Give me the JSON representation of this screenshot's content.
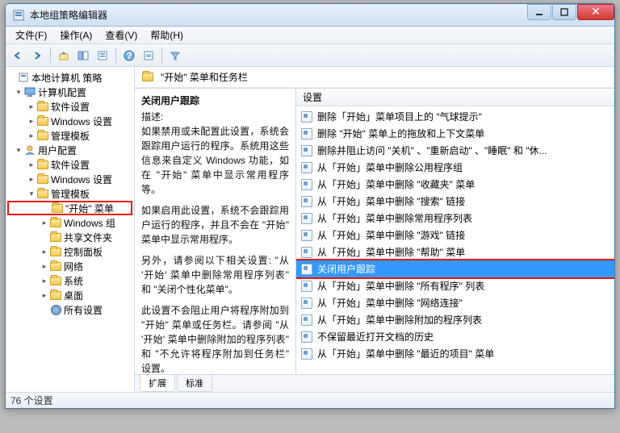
{
  "window": {
    "title": "本地组策略编辑器"
  },
  "menu": {
    "file": "文件(F)",
    "action": "操作(A)",
    "view": "查看(V)",
    "help": "帮助(H)"
  },
  "tree": {
    "root": "本地计算机 策略",
    "computer": "计算机配置",
    "c_soft": "软件设置",
    "c_win": "Windows 设置",
    "c_admin": "管理模板",
    "user": "用户配置",
    "u_soft": "软件设置",
    "u_win": "Windows 设置",
    "u_admin": "管理模板",
    "start": "\"开始\" 菜单",
    "wincomp": "Windows 组",
    "shared": "共享文件夹",
    "ctrl": "控制面板",
    "net": "网络",
    "sys": "系统",
    "desk": "桌面",
    "all": "所有设置"
  },
  "header": {
    "title": "\"开始\" 菜单和任务栏"
  },
  "desc": {
    "title": "关闭用户跟踪",
    "label": "描述:",
    "p1": "如果禁用或未配置此设置，系统会跟踪用户运行的程序。系统用这些信息来自定义 Windows 功能，如在 \"开始\" 菜单中显示常用程序等。",
    "p2": "如果启用此设置，系统不会跟踪用户运行的程序，并且不会在 \"开始\" 菜单中显示常用程序。",
    "p3": "另外，请参阅以下相关设置: \"从 '开始' 菜单中删除常用程序列表\" 和 \"关闭个性化菜单\"。",
    "p4": "此设置不会阻止用户将程序附加到 \"开始\" 菜单或任务栏。请参阅 \"从 '开始' 菜单中删除附加的程序列表\" 和 \"不允许将程序附加到任务栏\" 设置。"
  },
  "listHeader": "设置",
  "settings": [
    "删除「开始」菜单项目上的 \"气球提示\"",
    "删除 \"开始\" 菜单上的拖放和上下文菜单",
    "删除并阻止访问 \"关机\" 、\"重新启动\" 、\"睡眠\" 和 \"休...",
    "从「开始」菜单中删除公用程序组",
    "从「开始」菜单中删除 \"收藏夹\" 菜单",
    "从「开始」菜单中删除 \"搜索\" 链接",
    "从「开始」菜单中删除常用程序列表",
    "从「开始」菜单中删除 \"游戏\" 链接",
    "从「开始」菜单中删除 \"帮助\" 菜单",
    "关闭用户跟踪",
    "从「开始」菜单中删除 \"所有程序\" 列表",
    "从「开始」菜单中删除 \"网络连接\"",
    "从「开始」菜单中删除附加的程序列表",
    "不保留最近打开文档的历史",
    "从「开始」菜单中删除 \"最近的项目\" 菜单"
  ],
  "selectedIndex": 9,
  "tabs": {
    "ext": "扩展",
    "std": "标准"
  },
  "status": "76 个设置"
}
